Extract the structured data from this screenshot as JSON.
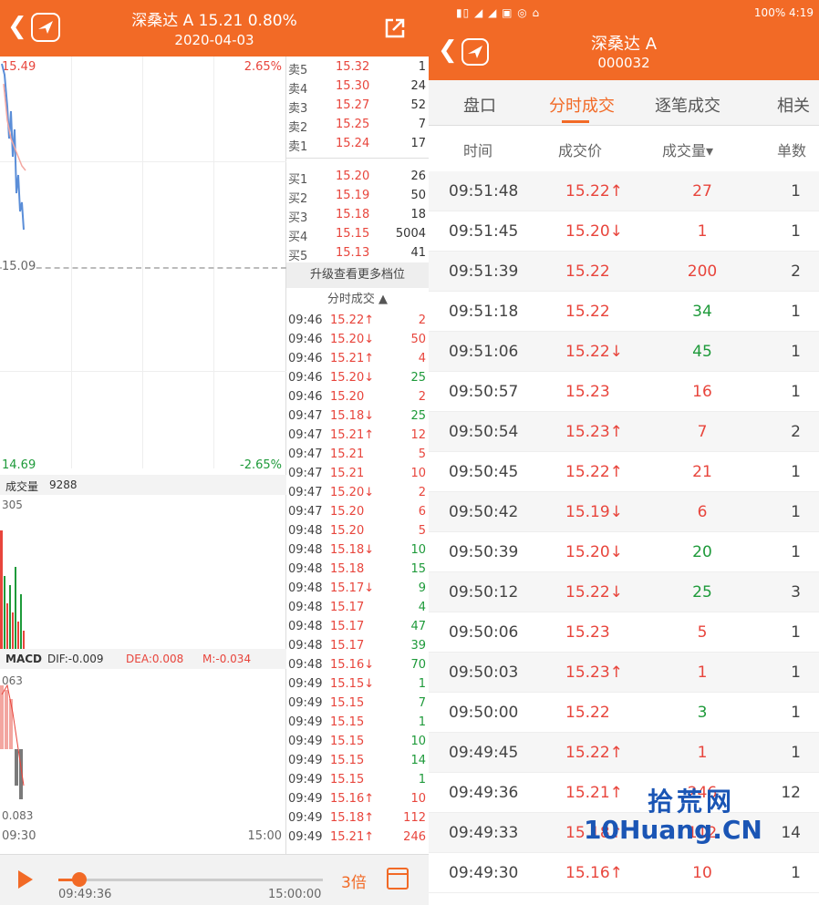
{
  "left_header": {
    "title": "深桑达 A  15.21  0.80%",
    "date": "2020-04-03"
  },
  "chart": {
    "price_high": "15.49",
    "pct_high": "2.65%",
    "mid_price": "15.09",
    "price_low": "14.69",
    "pct_low": "-2.65%",
    "volume_label": "成交量",
    "volume_value": "9288",
    "volume_max": "305",
    "macd_label": "MACD",
    "dif": "DIF:-0.009",
    "dea": "DEA:0.008",
    "m": "M:-0.034",
    "macd_high": "063",
    "macd_low": "0.083",
    "time_start": "09:30",
    "time_end": "15:00"
  },
  "order_book": {
    "asks": [
      {
        "name": "卖5",
        "price": "15.32",
        "vol": "1"
      },
      {
        "name": "卖4",
        "price": "15.30",
        "vol": "24"
      },
      {
        "name": "卖3",
        "price": "15.27",
        "vol": "52"
      },
      {
        "name": "卖2",
        "price": "15.25",
        "vol": "7"
      },
      {
        "name": "卖1",
        "price": "15.24",
        "vol": "17"
      }
    ],
    "bids": [
      {
        "name": "买1",
        "price": "15.20",
        "vol": "26"
      },
      {
        "name": "买2",
        "price": "15.19",
        "vol": "50"
      },
      {
        "name": "买3",
        "price": "15.18",
        "vol": "18"
      },
      {
        "name": "买4",
        "price": "15.15",
        "vol": "5004"
      },
      {
        "name": "买5",
        "price": "15.13",
        "vol": "41"
      }
    ],
    "upgrade": "升级查看更多档位",
    "tick_title": "分时成交 ▲"
  },
  "ticks": [
    {
      "t": "09:46",
      "p": "15.22↑",
      "v": "2",
      "c": "red"
    },
    {
      "t": "09:46",
      "p": "15.20↓",
      "v": "50",
      "c": "red"
    },
    {
      "t": "09:46",
      "p": "15.21↑",
      "v": "4",
      "c": "red"
    },
    {
      "t": "09:46",
      "p": "15.20↓",
      "v": "25",
      "c": "green"
    },
    {
      "t": "09:46",
      "p": "15.20",
      "v": "2",
      "c": "red"
    },
    {
      "t": "09:47",
      "p": "15.18↓",
      "v": "25",
      "c": "green"
    },
    {
      "t": "09:47",
      "p": "15.21↑",
      "v": "12",
      "c": "red"
    },
    {
      "t": "09:47",
      "p": "15.21",
      "v": "5",
      "c": "red"
    },
    {
      "t": "09:47",
      "p": "15.21",
      "v": "10",
      "c": "red"
    },
    {
      "t": "09:47",
      "p": "15.20↓",
      "v": "2",
      "c": "red"
    },
    {
      "t": "09:47",
      "p": "15.20",
      "v": "6",
      "c": "red"
    },
    {
      "t": "09:48",
      "p": "15.20",
      "v": "5",
      "c": "red"
    },
    {
      "t": "09:48",
      "p": "15.18↓",
      "v": "10",
      "c": "green"
    },
    {
      "t": "09:48",
      "p": "15.18",
      "v": "15",
      "c": "green"
    },
    {
      "t": "09:48",
      "p": "15.17↓",
      "v": "9",
      "c": "green"
    },
    {
      "t": "09:48",
      "p": "15.17",
      "v": "4",
      "c": "green"
    },
    {
      "t": "09:48",
      "p": "15.17",
      "v": "47",
      "c": "green"
    },
    {
      "t": "09:48",
      "p": "15.17",
      "v": "39",
      "c": "green"
    },
    {
      "t": "09:48",
      "p": "15.16↓",
      "v": "70",
      "c": "green"
    },
    {
      "t": "09:49",
      "p": "15.15↓",
      "v": "1",
      "c": "green"
    },
    {
      "t": "09:49",
      "p": "15.15",
      "v": "7",
      "c": "green"
    },
    {
      "t": "09:49",
      "p": "15.15",
      "v": "1",
      "c": "green"
    },
    {
      "t": "09:49",
      "p": "15.15",
      "v": "10",
      "c": "green"
    },
    {
      "t": "09:49",
      "p": "15.15",
      "v": "14",
      "c": "green"
    },
    {
      "t": "09:49",
      "p": "15.15",
      "v": "1",
      "c": "green"
    },
    {
      "t": "09:49",
      "p": "15.16↑",
      "v": "10",
      "c": "red"
    },
    {
      "t": "09:49",
      "p": "15.18↑",
      "v": "112",
      "c": "red"
    },
    {
      "t": "09:49",
      "p": "15.21↑",
      "v": "246",
      "c": "red"
    }
  ],
  "player": {
    "current_time": "09:49:36",
    "end_time": "15:00:00",
    "speed": "3倍",
    "progress": 0.08
  },
  "right_header": {
    "status_left": "▮▯ ◢ ◢ ▣ ◎ ⌂",
    "status_right": "100%  4:19",
    "title": "深桑达 A",
    "code": "000032"
  },
  "tabs": [
    "盘口",
    "分时成交",
    "逐笔成交",
    "相关"
  ],
  "columns": [
    "时间",
    "成交价",
    "成交量▾",
    "单数"
  ],
  "trades": [
    {
      "time": "09:51:48",
      "price": "15.22↑",
      "vol": "27",
      "vc": "red",
      "cnt": "1"
    },
    {
      "time": "09:51:45",
      "price": "15.20↓",
      "vol": "1",
      "vc": "red",
      "cnt": "1"
    },
    {
      "time": "09:51:39",
      "price": "15.22",
      "vol": "200",
      "vc": "red",
      "cnt": "2"
    },
    {
      "time": "09:51:18",
      "price": "15.22",
      "vol": "34",
      "vc": "green",
      "cnt": "1"
    },
    {
      "time": "09:51:06",
      "price": "15.22↓",
      "vol": "45",
      "vc": "green",
      "cnt": "1"
    },
    {
      "time": "09:50:57",
      "price": "15.23",
      "vol": "16",
      "vc": "red",
      "cnt": "1"
    },
    {
      "time": "09:50:54",
      "price": "15.23↑",
      "vol": "7",
      "vc": "red",
      "cnt": "2"
    },
    {
      "time": "09:50:45",
      "price": "15.22↑",
      "vol": "21",
      "vc": "red",
      "cnt": "1"
    },
    {
      "time": "09:50:42",
      "price": "15.19↓",
      "vol": "6",
      "vc": "red",
      "cnt": "1"
    },
    {
      "time": "09:50:39",
      "price": "15.20↓",
      "vol": "20",
      "vc": "green",
      "cnt": "1"
    },
    {
      "time": "09:50:12",
      "price": "15.22↓",
      "vol": "25",
      "vc": "green",
      "cnt": "3"
    },
    {
      "time": "09:50:06",
      "price": "15.23",
      "vol": "5",
      "vc": "red",
      "cnt": "1"
    },
    {
      "time": "09:50:03",
      "price": "15.23↑",
      "vol": "1",
      "vc": "red",
      "cnt": "1"
    },
    {
      "time": "09:50:00",
      "price": "15.22",
      "vol": "3",
      "vc": "green",
      "cnt": "1"
    },
    {
      "time": "09:49:45",
      "price": "15.22↑",
      "vol": "1",
      "vc": "red",
      "cnt": "1"
    },
    {
      "time": "09:49:36",
      "price": "15.21↑",
      "vol": "246",
      "vc": "red",
      "cnt": "12"
    },
    {
      "time": "09:49:33",
      "price": "15.18↑",
      "vol": "112",
      "vc": "red",
      "cnt": "14"
    },
    {
      "time": "09:49:30",
      "price": "15.16↑",
      "vol": "10",
      "vc": "red",
      "cnt": "1"
    }
  ],
  "watermark": {
    "cn": "拾荒网",
    "en": "10Huang.CN"
  },
  "colors": {
    "accent": "#f26a26",
    "up": "#e8453c",
    "down": "#1e9a3a"
  }
}
